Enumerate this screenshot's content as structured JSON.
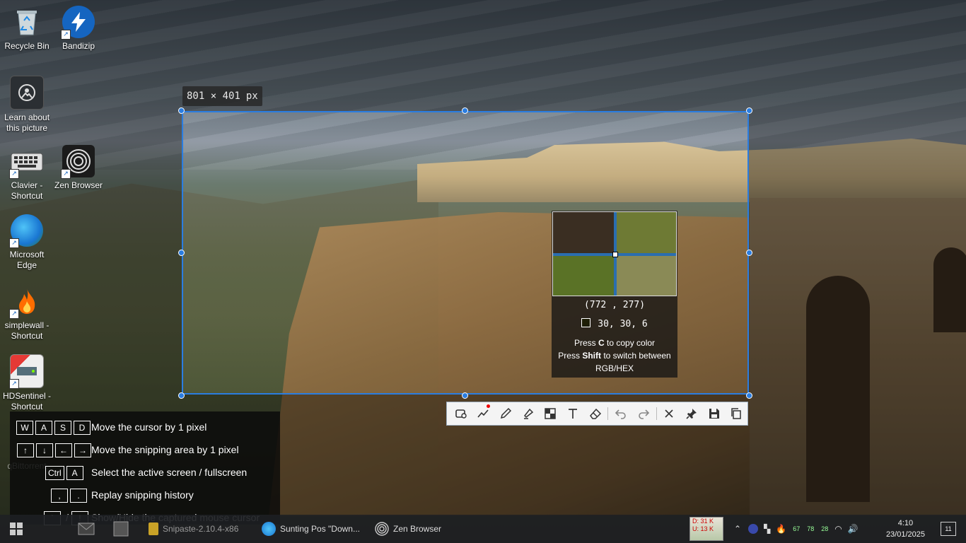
{
  "desktop": {
    "icons": [
      {
        "label": "Recycle Bin"
      },
      {
        "label": "Bandizip"
      },
      {
        "label": "Learn about this picture"
      },
      {
        "label": "Clavier - Shortcut"
      },
      {
        "label": "Zen Browser"
      },
      {
        "label": "Microsoft Edge"
      },
      {
        "label": "simplewall - Shortcut"
      },
      {
        "label": "HDSentinel - Shortcut"
      },
      {
        "label": "qBittorrent"
      }
    ]
  },
  "snip": {
    "size_text": "801 × 401",
    "size_unit": "px",
    "magnifier": {
      "coords": "(772 , 277)",
      "rgb": "30,  30,   6",
      "copy_press": "Press",
      "copy_key": "C",
      "copy_rest": "to copy color",
      "switch_press": "Press",
      "switch_key": "Shift",
      "switch_rest": "to switch between",
      "switch_rest2": "RGB/HEX"
    },
    "toolbar": [
      {
        "name": "rectangle-tool",
        "icon": "rectangle-icon"
      },
      {
        "name": "polyline-tool",
        "icon": "polyline-icon"
      },
      {
        "name": "pencil-tool",
        "icon": "pencil-icon"
      },
      {
        "name": "marker-tool",
        "icon": "marker-icon"
      },
      {
        "name": "mosaic-tool",
        "icon": "mosaic-icon"
      },
      {
        "name": "text-tool",
        "icon": "text-icon"
      },
      {
        "name": "eraser-tool",
        "icon": "eraser-icon"
      },
      {
        "name": "undo",
        "icon": "undo-icon"
      },
      {
        "name": "redo",
        "icon": "redo-icon"
      },
      {
        "name": "close",
        "icon": "close-icon"
      },
      {
        "name": "pin",
        "icon": "pin-icon"
      },
      {
        "name": "save",
        "icon": "save-icon"
      },
      {
        "name": "copy",
        "icon": "copy-icon"
      }
    ],
    "shortcuts": [
      {
        "keys": [
          "W",
          "A",
          "S",
          "D"
        ],
        "desc": "Move the cursor by 1 pixel"
      },
      {
        "keys": [
          "↑",
          "↓",
          "←",
          "→"
        ],
        "desc": "Move the snipping area by 1 pixel"
      },
      {
        "keys": [
          "Ctrl",
          "A"
        ],
        "desc": "Select the active screen / fullscreen"
      },
      {
        "keys": [
          ",",
          "."
        ],
        "desc": "Replay snipping history"
      },
      {
        "keys": [
          "`",
          "!"
        ],
        "sep": "/",
        "desc": "Show/Hide the captured mouse cursor"
      }
    ]
  },
  "taskbar": {
    "tasks": [
      {
        "label": "Snipaste-2.10.4-x86"
      },
      {
        "label": "Sunting Pos \"Down..."
      },
      {
        "label": "Zen Browser"
      }
    ],
    "netmeter": {
      "down": "D: 31 K",
      "up": "U: 13 K"
    },
    "tray_badges": [
      "67",
      "78",
      "28"
    ],
    "time": "4:10",
    "date": "23/01/2025",
    "notifications": "11"
  }
}
